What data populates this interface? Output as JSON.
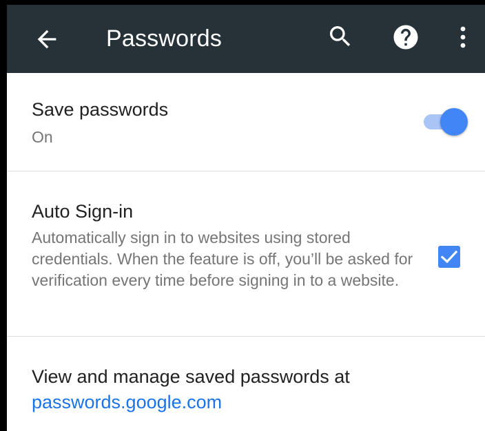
{
  "appbar": {
    "title": "Passwords",
    "icons": {
      "back": "arrow-back-icon",
      "search": "search-icon",
      "help": "help-circle-icon",
      "more": "more-vert-icon"
    },
    "background_color": "#263238"
  },
  "save_passwords": {
    "title": "Save passwords",
    "status": "On",
    "toggle_on": true,
    "accent_color": "#4285f4"
  },
  "auto_signin": {
    "title": "Auto Sign-in",
    "description": "Automatically sign in to websites using stored credentials. When the feature is off, you’ll be asked for verification every time before signing in to a website.",
    "checked": true
  },
  "manage": {
    "text": "View and manage saved passwords at",
    "link": "passwords.google.com",
    "link_color": "#1a73e8"
  }
}
